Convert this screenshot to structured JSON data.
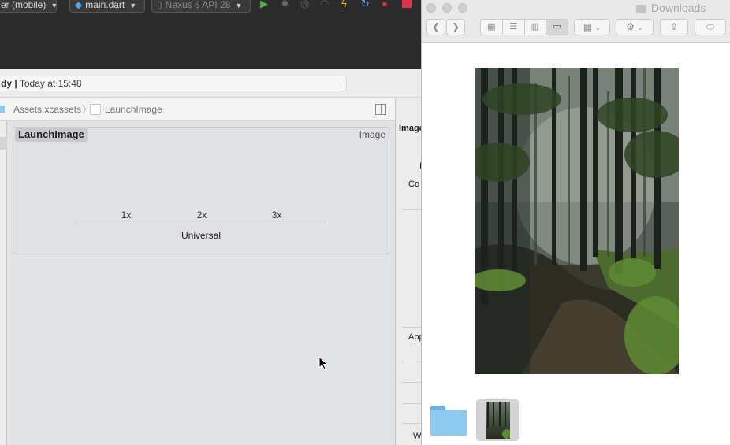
{
  "ide_toolbar": {
    "scheme_label": "er (mobile)",
    "target_file": "main.dart",
    "device": "Nexus 6 API 28"
  },
  "status": {
    "state": "dy",
    "separator": "|",
    "time": "Today at 15:48"
  },
  "breadcrumb": {
    "items": [
      "Assets.xcassets",
      "LaunchImage"
    ],
    "separator": "〉"
  },
  "asset": {
    "name": "LaunchImage",
    "type_label": "Image",
    "slots": [
      "1x",
      "2x",
      "3x"
    ],
    "idiom": "Universal"
  },
  "inspector": {
    "header": "Image",
    "row_1": "I",
    "row_2": "Co",
    "row_3": "App",
    "row_4": "W"
  },
  "finder": {
    "title": "Downloads",
    "view_modes": [
      "icon",
      "list",
      "column",
      "gallery"
    ],
    "active_view": "gallery"
  },
  "colors": {
    "ide_dark": "#2b2b2c",
    "editor_bg": "#e1e3e6",
    "folder_blue": "#8ccaf2",
    "run_green": "#4caf3f",
    "stop_red": "#e0314b"
  }
}
